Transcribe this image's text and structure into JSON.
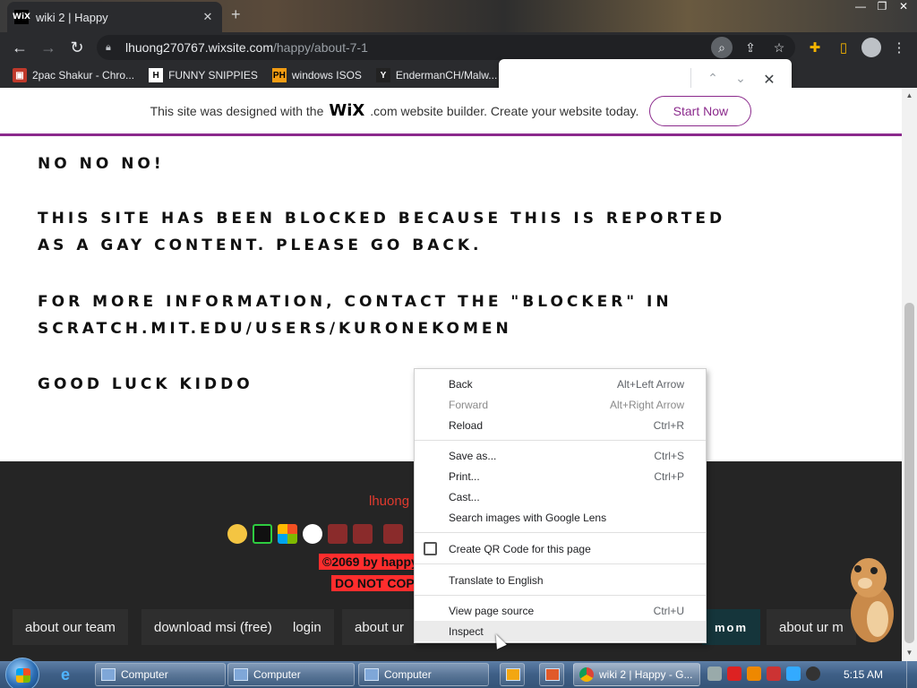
{
  "browser": {
    "tab_title": "wiki 2 | Happy",
    "tab_favicon": "WiX",
    "url_host": "lhuong270767.wixsite.com",
    "url_path": "/happy/about-7-1"
  },
  "bookmarks": [
    {
      "label": "2pac Shakur - Chro...",
      "icon": "2pac-icon"
    },
    {
      "label": "FUNNY SNIPPIES",
      "icon": "H"
    },
    {
      "label": "windows ISOS",
      "icon": "PH"
    },
    {
      "label": "EndermanCH/Malw...",
      "icon": "Y"
    }
  ],
  "find_bar": {
    "value": ""
  },
  "wix_banner": {
    "text_before": "This site was designed with the",
    "logo": "WiX",
    "text_after": ".com website builder. Create your website today.",
    "button": "Start Now",
    "accent": "#8b2a8c"
  },
  "content": {
    "lines": [
      "NO NO NO!",
      "THIS SITE HAS BEEN BLOCKED BECAUSE THIS IS REPORTED",
      "AS A GAY CONTENT. PLEASE GO BACK.",
      "FOR MORE INFORMATION, CONTACT THE \"BLOCKER\" IN",
      "SCRATCH.MIT.EDU/USERS/KURONEKOMEN",
      "GOOD LUCK KIDDO"
    ]
  },
  "footer": {
    "site_name": "lhuong",
    "copyright": "©2069 by happy",
    "warning": "DO NOT COPY",
    "nav": [
      "about our team",
      "download msi (free)",
      "login",
      "about ur",
      "mom",
      "about ur m"
    ],
    "accent_red": "#ff2d2d"
  },
  "context_menu": {
    "items": [
      {
        "label": "Back",
        "shortcut": "Alt+Left Arrow",
        "disabled": false
      },
      {
        "label": "Forward",
        "shortcut": "Alt+Right Arrow",
        "disabled": true
      },
      {
        "label": "Reload",
        "shortcut": "Ctrl+R",
        "disabled": false
      },
      {
        "label": "Save as...",
        "shortcut": "Ctrl+S",
        "disabled": false
      },
      {
        "label": "Print...",
        "shortcut": "Ctrl+P",
        "disabled": false
      },
      {
        "label": "Cast...",
        "shortcut": "",
        "disabled": false
      },
      {
        "label": "Search images with Google Lens",
        "shortcut": "",
        "disabled": false
      },
      {
        "label": "Create QR Code for this page",
        "shortcut": "",
        "disabled": false
      },
      {
        "label": "Translate to English",
        "shortcut": "",
        "disabled": false
      },
      {
        "label": "View page source",
        "shortcut": "Ctrl+U",
        "disabled": false
      },
      {
        "label": "Inspect",
        "shortcut": "",
        "disabled": false
      }
    ]
  },
  "taskbar": {
    "buttons": [
      "Computer",
      "Computer",
      "Computer",
      "wiki 2 | Happy - G..."
    ],
    "clock": "5:15 AM"
  }
}
